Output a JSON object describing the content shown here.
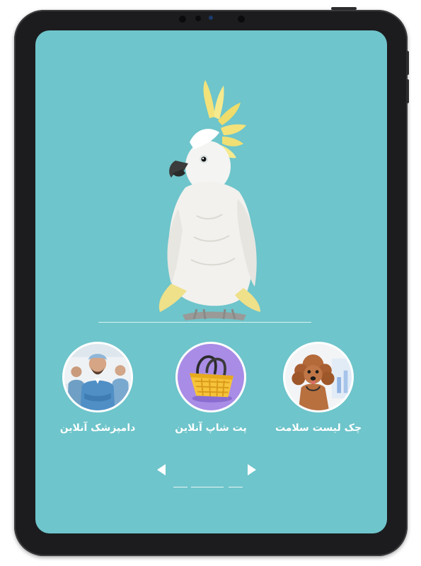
{
  "app": {
    "accent_color": "#6ec5cb",
    "device_color": "#1c1c1e"
  },
  "hero": {
    "image": "cockatoo-illustration"
  },
  "categories": [
    {
      "label": "دامپزشک آنلاین",
      "icon": "veterinarian-doctors-photo"
    },
    {
      "label": "پت شاپ آنلاین",
      "icon": "shopping-basket-photo"
    },
    {
      "label": "چک لیست سلامت",
      "icon": "poodle-dog-photo"
    }
  ],
  "carousel": {
    "prev_icon": "triangle-left-icon",
    "next_icon": "triangle-right-icon",
    "pages": 3,
    "active_page": 2
  }
}
